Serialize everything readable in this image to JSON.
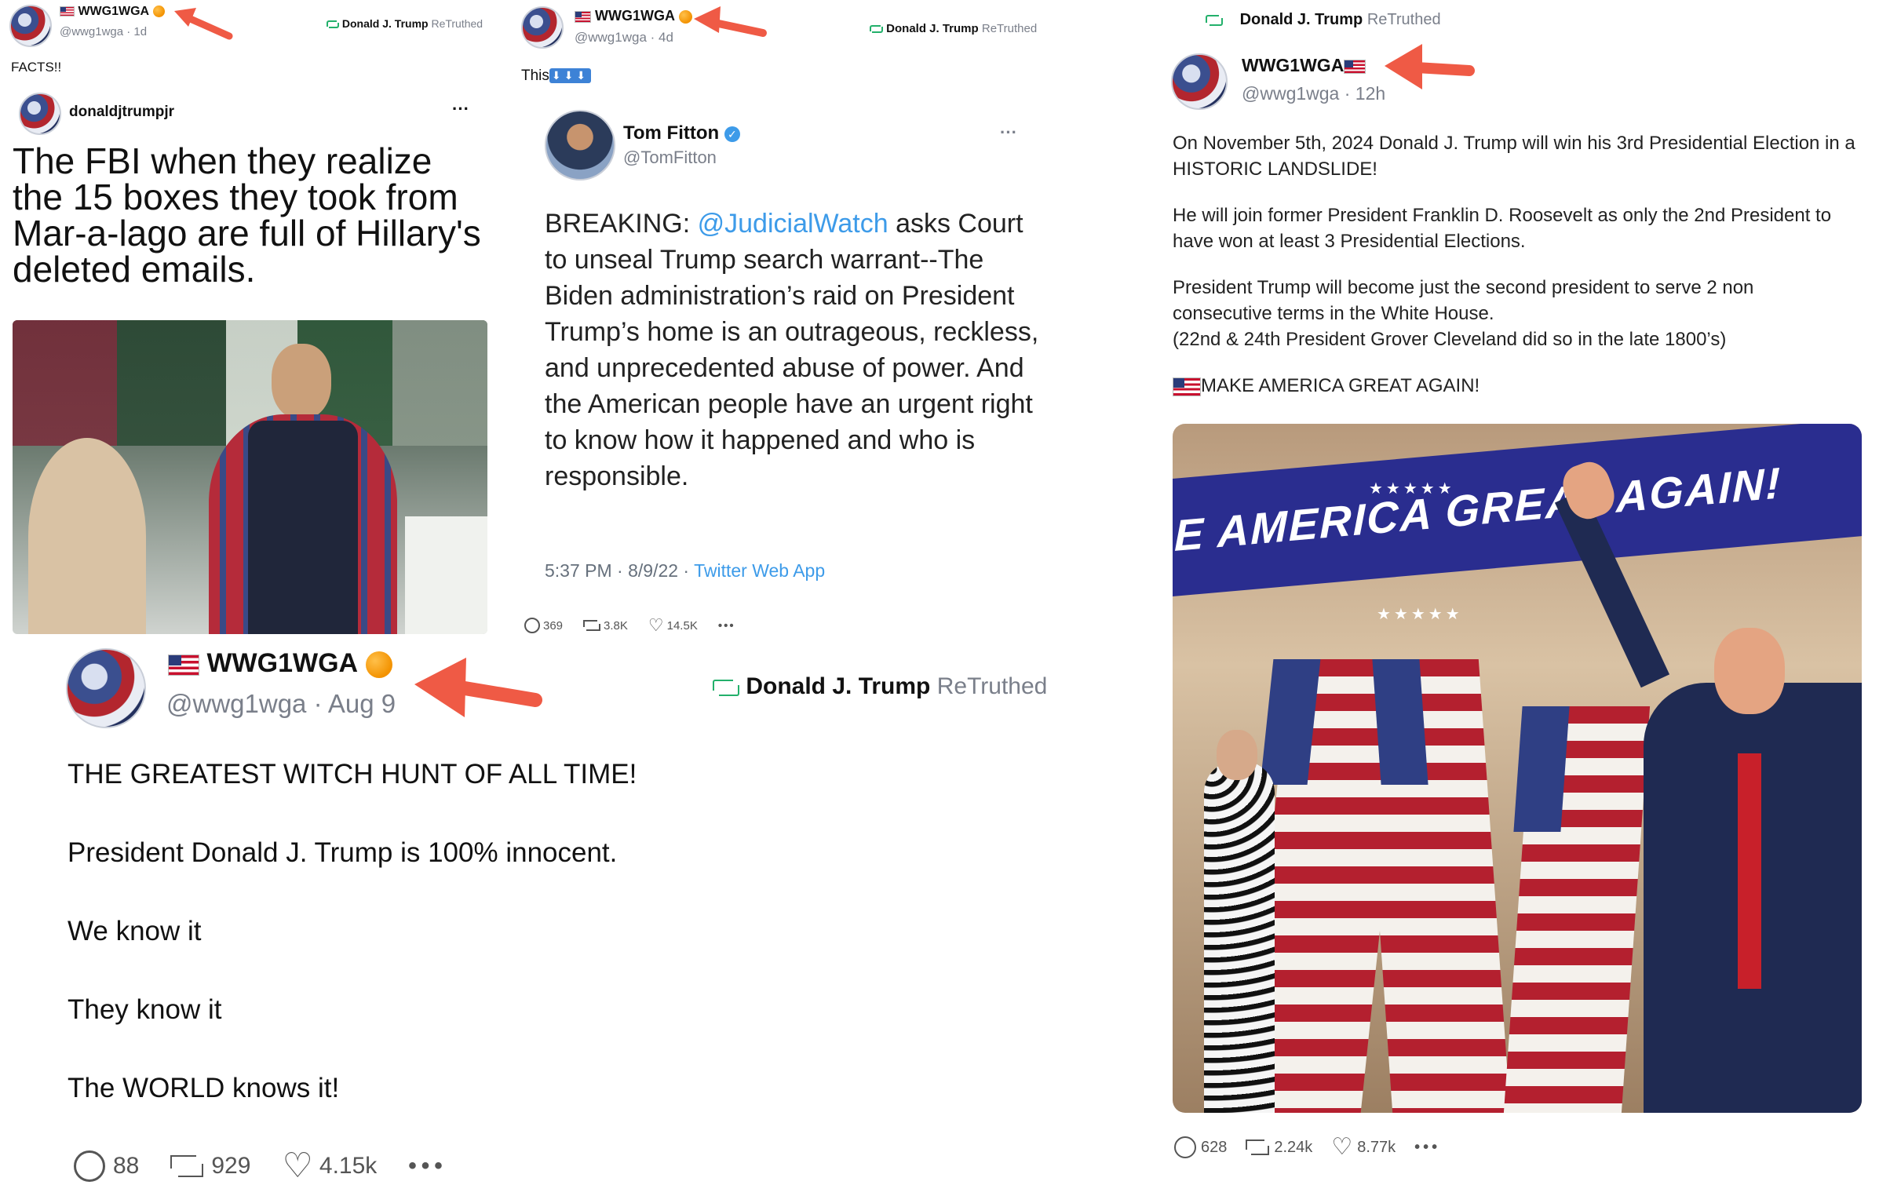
{
  "post1": {
    "display_name": "WWG1WGA",
    "handle_meta": "@wwg1wga · 1d",
    "retruth_by": "Donald J. Trump",
    "retruth_label": "ReTruthed",
    "text": "FACTS!!",
    "embed": {
      "username": "donaldjtrumpjr",
      "more": "···",
      "meme_text": "The FBI when they realize the 15 boxes they took from Mar-a-lago are full of Hillary's deleted emails."
    }
  },
  "post2": {
    "display_name": "WWG1WGA",
    "handle_meta": "@wwg1wga · 4d",
    "retruth_by": "Donald J. Trump",
    "retruth_label": "ReTruthed",
    "text": "This",
    "embed": {
      "name": "Tom Fitton",
      "handle": "@TomFitton",
      "more": "···",
      "lead": "BREAKING:",
      "mention": "@JudicialWatch",
      "body": "asks Court to unseal Trump search warrant--The Biden administration’s raid on President Trump’s home is an outrageous, reckless, and unprecedented abuse of power. And the American people have an urgent right to know how it happened and who is responsible.",
      "timestamp": "5:37 PM · 8/9/22 ·",
      "source": "Twitter Web App"
    },
    "stats": {
      "replies": "369",
      "retruths": "3.8K",
      "likes": "14.5K",
      "more": "•••"
    }
  },
  "post3": {
    "display_name": "WWG1WGA",
    "handle_meta": "@wwg1wga · Aug 9",
    "retruth_by": "Donald J. Trump",
    "retruth_label": "ReTruthed",
    "lines": [
      "THE GREATEST WITCH HUNT OF ALL TIME!",
      "President Donald J. Trump is 100% innocent.",
      "We know it",
      "They know it",
      "The WORLD knows it!"
    ],
    "stats": {
      "replies": "88",
      "retruths": "929",
      "likes": "4.15k",
      "more": "•••"
    }
  },
  "post4": {
    "retruth_by": "Donald J. Trump",
    "retruth_label": "ReTruthed",
    "display_name": "WWG1WGA",
    "handle_meta": "@wwg1wga · 12h",
    "paragraphs": [
      "On November 5th, 2024 Donald J. Trump will win his 3rd Presidential Election in a HISTORIC LANDSLIDE!",
      "He will join former President Franklin D. Roosevelt as only the 2nd President to have won at least 3 Presidential Elections.",
      "President Trump will become just the second president to serve 2 non consecutive terms in the White House.",
      "(22nd & 24th President Grover Cleveland did so in the late 1800’s)",
      "MAKE AMERICA GREAT AGAIN!"
    ],
    "banner_text": "E AMERICA GREAT AGAIN!",
    "stats": {
      "replies": "628",
      "retruths": "2.24k",
      "likes": "8.77k",
      "more": "•••"
    }
  },
  "colors": {
    "arrow": "#ef5a45",
    "retruth_green": "#23b06b",
    "link_blue": "#3d9be9",
    "banner_blue": "#2a2d8f"
  }
}
